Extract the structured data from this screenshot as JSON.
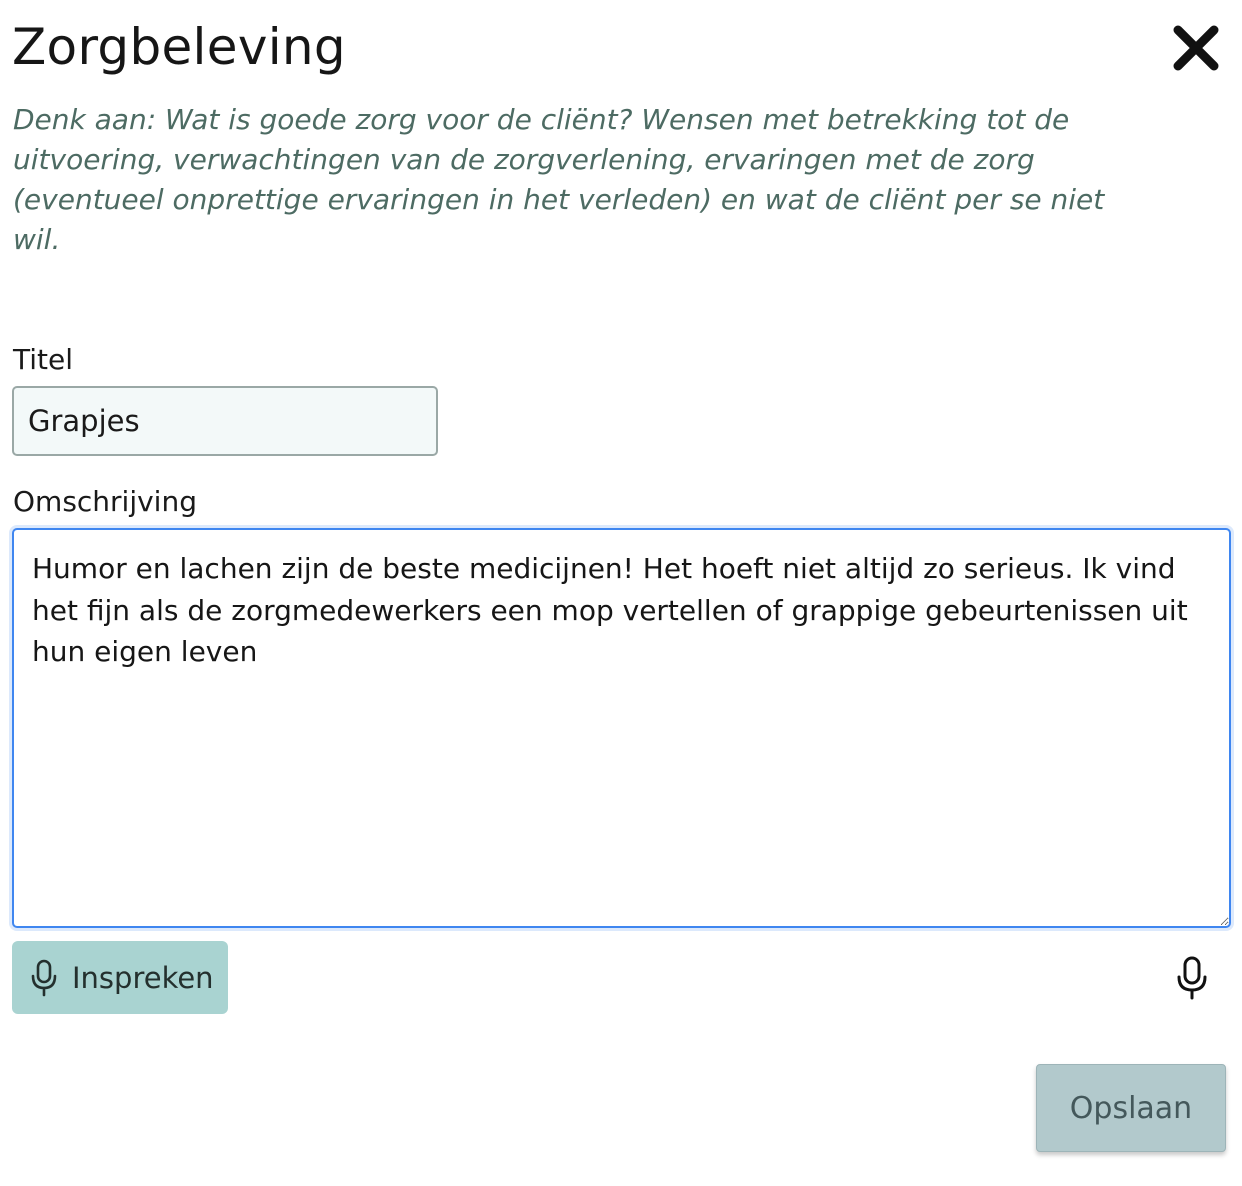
{
  "dialog": {
    "title": "Zorgbeleving",
    "close_icon": "close-icon",
    "hint": "Denk aan: Wat is goede zorg voor de cliënt? Wensen met betrekking tot de uitvoering, verwachtingen van de zorgverlening, ervaringen met de zorg (eventueel onprettige ervaringen in het verleden) en wat de cliënt per se niet wil."
  },
  "form": {
    "title_label": "Titel",
    "title_value": "Grapjes",
    "description_label": "Omschrijving",
    "description_value": "Humor en lachen zijn de beste medicijnen! Het hoeft niet altijd zo serieus. Ik vind het fijn als de zorgmedewerkers een mop vertellen of grappige gebeurtenissen uit hun eigen leven"
  },
  "actions": {
    "dictate_label": "Inspreken",
    "dictate_icon": "microphone-icon",
    "mic_icon": "microphone-icon",
    "save_label": "Opslaan"
  },
  "colors": {
    "hint_text": "#4d6b63",
    "dictate_button": "#a9d3d1",
    "save_button": "#b2c9cc",
    "focus_border": "#3f86f0"
  }
}
